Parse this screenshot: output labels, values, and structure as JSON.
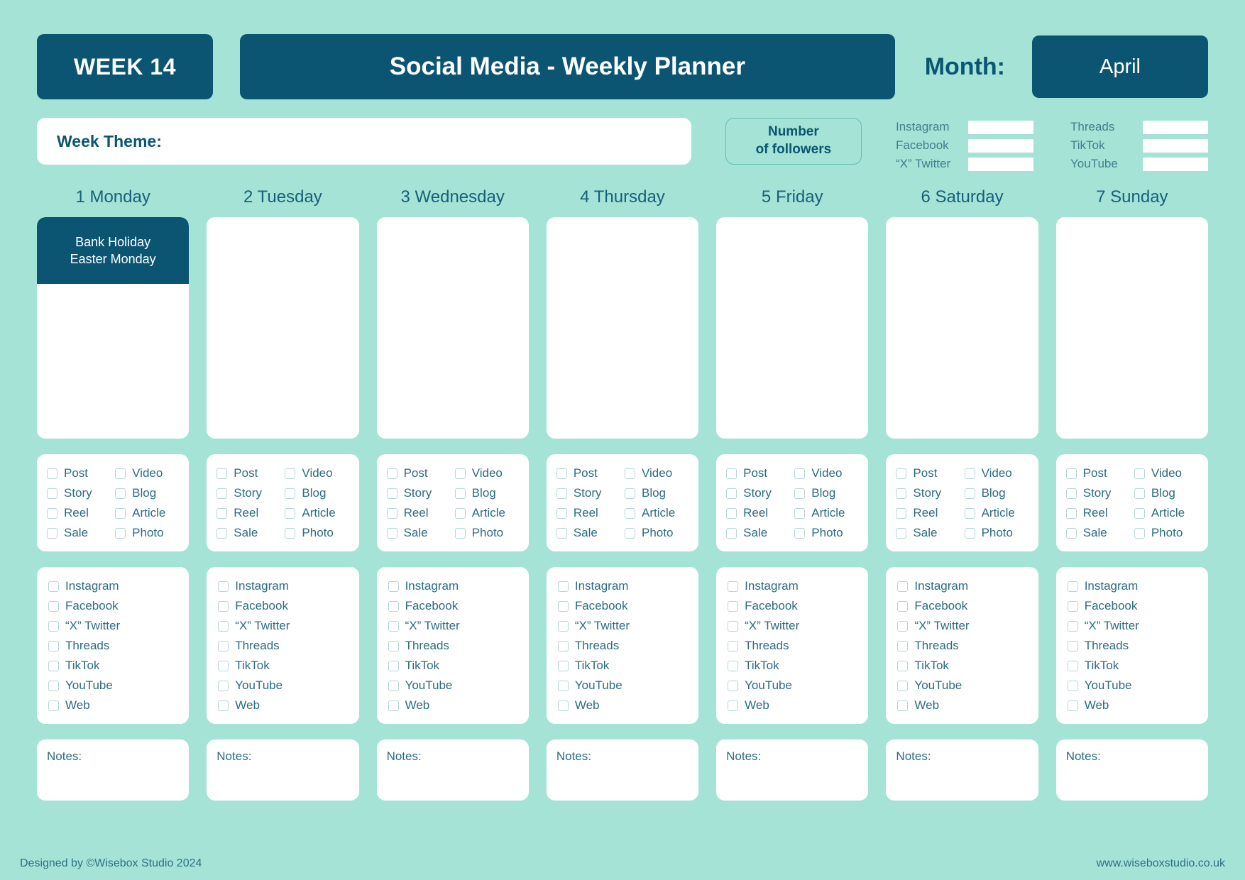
{
  "header": {
    "week_badge": "WEEK 14",
    "title": "Social Media - Weekly Planner",
    "month_label": "Month:",
    "month_value": "April"
  },
  "subheader": {
    "week_theme_label": "Week Theme:",
    "week_theme_value": "",
    "followers_line1": "Number",
    "followers_line2": "of followers",
    "followers_left": [
      {
        "name": "Instagram",
        "value": ""
      },
      {
        "name": "Facebook",
        "value": ""
      },
      {
        "name": "“X” Twitter",
        "value": ""
      }
    ],
    "followers_right": [
      {
        "name": "Threads",
        "value": ""
      },
      {
        "name": "TikTok",
        "value": ""
      },
      {
        "name": "YouTube",
        "value": ""
      }
    ]
  },
  "content_types": [
    "Post",
    "Video",
    "Story",
    "Blog",
    "Reel",
    "Article",
    "Sale",
    "Photo"
  ],
  "platforms": [
    "Instagram",
    "Facebook",
    "“X” Twitter",
    "Threads",
    "TikTok",
    "YouTube",
    "Web"
  ],
  "notes_label": "Notes:",
  "days": [
    {
      "title": "1 Monday",
      "holiday": "Bank Holiday\nEaster Monday",
      "plan": "",
      "notes": ""
    },
    {
      "title": "2 Tuesday",
      "holiday": "",
      "plan": "",
      "notes": ""
    },
    {
      "title": "3 Wednesday",
      "holiday": "",
      "plan": "",
      "notes": ""
    },
    {
      "title": "4 Thursday",
      "holiday": "",
      "plan": "",
      "notes": ""
    },
    {
      "title": "5 Friday",
      "holiday": "",
      "plan": "",
      "notes": ""
    },
    {
      "title": "6 Saturday",
      "holiday": "",
      "plan": "",
      "notes": ""
    },
    {
      "title": "7 Sunday",
      "holiday": "",
      "plan": "",
      "notes": ""
    }
  ],
  "footer": {
    "left": "Designed by ©Wisebox Studio 2024",
    "right": "www.wiseboxstudio.co.uk"
  },
  "colors": {
    "background": "#a6e3d7",
    "accent_dark": "#0b5573",
    "card": "#ffffff",
    "text_muted": "#2d6c80"
  }
}
